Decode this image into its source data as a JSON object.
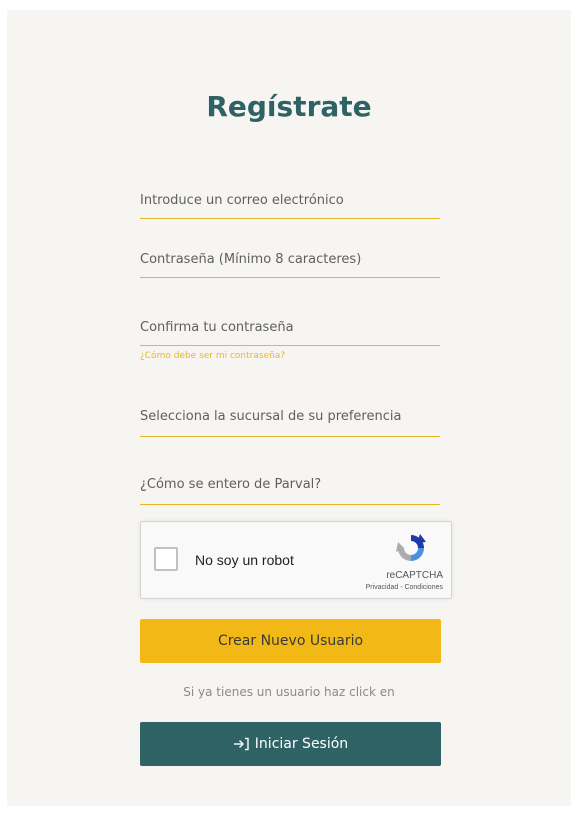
{
  "form": {
    "title": "Regístrate",
    "email_placeholder": "Introduce un correo electrónico",
    "password_placeholder": "Contraseña (Mínimo 8 caracteres)",
    "confirm_placeholder": "Confirma tu contraseña",
    "password_hint": "¿Cómo debe ser mi contraseña?",
    "branch_select": "Selecciona la sucursal de su preferencia",
    "source_select": "¿Cómo se entero de Parval?"
  },
  "captcha": {
    "label": "No soy un robot",
    "brand": "reCAPTCHA",
    "legal": "Privacidad - Condiciones"
  },
  "actions": {
    "create_label": "Crear Nuevo Usuario",
    "have_account_text": "Si ya tienes un usuario haz click en",
    "login_label": "Iniciar Sesión"
  },
  "colors": {
    "primary": "#2f6264",
    "accent": "#f2b916",
    "background": "#f7f5f2"
  },
  "icons": {
    "login": "sign-in-icon",
    "captcha": "recaptcha-logo-icon"
  }
}
